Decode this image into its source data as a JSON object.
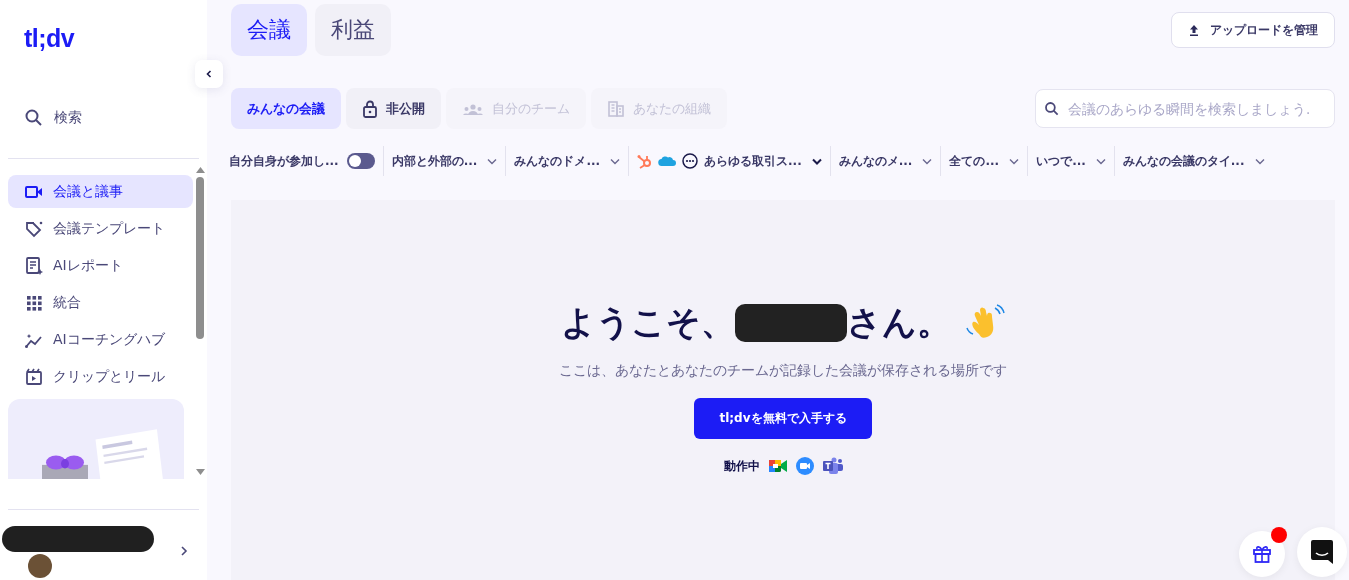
{
  "sidebar": {
    "logo": "tl;dv",
    "search": "検索",
    "items": [
      {
        "label": "会議と議事",
        "selected": true
      },
      {
        "label": "会議テンプレート",
        "selected": false
      },
      {
        "label": "AIレポート",
        "selected": false
      },
      {
        "label": "統合",
        "selected": false
      },
      {
        "label": "AIコーチングハブ",
        "selected": false
      },
      {
        "label": "クリップとリール",
        "selected": false
      }
    ]
  },
  "top_tabs": [
    {
      "label": "会議",
      "selected": true
    },
    {
      "label": "利益",
      "selected": false
    }
  ],
  "upload_button": "アップロードを管理",
  "scope_tabs": [
    {
      "label": "みんなの会議",
      "selected": true,
      "disabled": false
    },
    {
      "label": "非公開",
      "selected": false,
      "disabled": false
    },
    {
      "label": "自分のチーム",
      "selected": false,
      "disabled": true
    },
    {
      "label": "あなたの組織",
      "selected": false,
      "disabled": true
    }
  ],
  "search": {
    "placeholder": "会議のあらゆる瞬間を検索しましょう."
  },
  "filters": [
    {
      "kind": "toggle",
      "label": "自分自身が参加し...",
      "on": false
    },
    {
      "kind": "dropdown",
      "label": "内部と外部の..."
    },
    {
      "kind": "dropdown",
      "label": "みんなのドメ..."
    },
    {
      "kind": "crm",
      "label": "あらゆる取引ス..."
    },
    {
      "kind": "dropdown",
      "label": "みんなのメ..."
    },
    {
      "kind": "dropdown",
      "label": "全ての..."
    },
    {
      "kind": "dropdown",
      "label": "いつで..."
    },
    {
      "kind": "dropdown",
      "label": "みんなの会議のタイ..."
    }
  ],
  "welcome": {
    "greeting": "ようこそ、",
    "suffix": "さん。",
    "subtitle": "ここは、あなたとあなたのチームが記録した会議が保存される場所です",
    "cta": "tl;dvを無料で入手する",
    "works_with": "動作中"
  },
  "gift_notification": true
}
